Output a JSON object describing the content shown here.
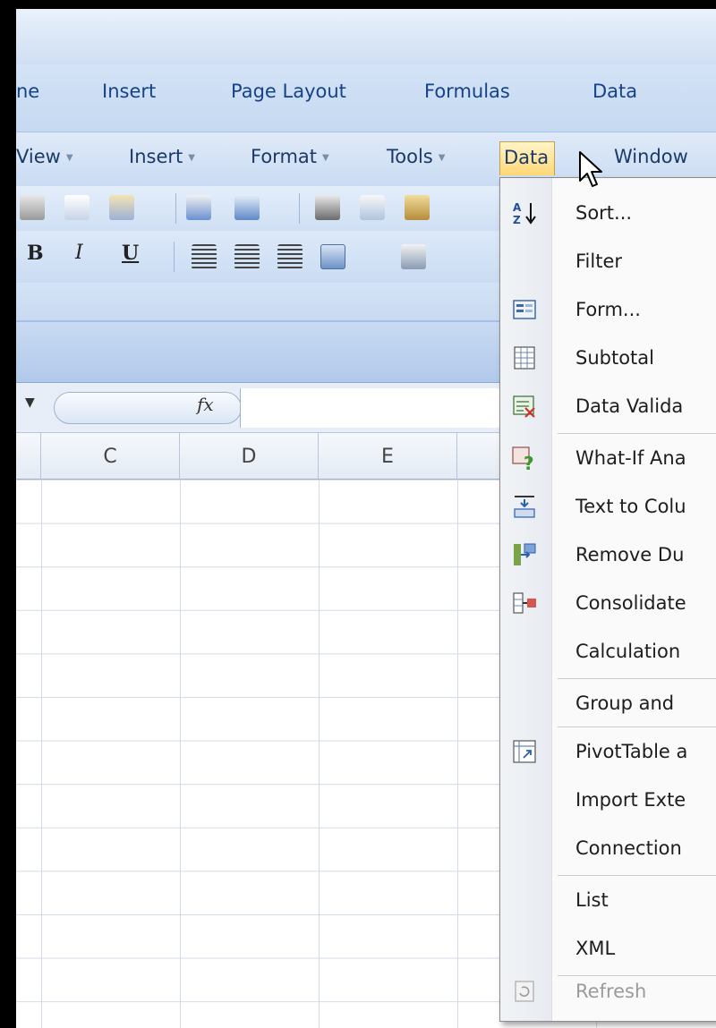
{
  "ribbon": {
    "tabs": [
      "ne",
      "Insert",
      "Page Layout",
      "Formulas",
      "Data"
    ]
  },
  "menubar": {
    "items": [
      {
        "label": "View"
      },
      {
        "label": "Insert"
      },
      {
        "label": "Format"
      },
      {
        "label": "Tools"
      },
      {
        "label": "Data"
      },
      {
        "label": "Window"
      }
    ],
    "active": "Data"
  },
  "toolbar": {
    "bold": "B",
    "italic": "I",
    "underline": "U"
  },
  "formula_bar": {
    "fx": "fx",
    "value": ""
  },
  "columns": [
    "C",
    "D",
    "E"
  ],
  "data_menu": {
    "items": [
      {
        "label": "Sort...",
        "icon": "sort-az-icon"
      },
      {
        "label": "Filter",
        "icon": ""
      },
      {
        "label": "Form...",
        "icon": "form-icon"
      },
      {
        "label": "Subtotal",
        "icon": "subtotal-icon"
      },
      {
        "label": "Data Valida",
        "icon": "data-validation-icon"
      },
      {
        "label": "What-If Ana",
        "icon": "what-if-icon"
      },
      {
        "label": "Text to Colu",
        "icon": "text-to-columns-icon"
      },
      {
        "label": "Remove Du",
        "icon": "remove-duplicates-icon"
      },
      {
        "label": "Consolidate",
        "icon": "consolidate-icon"
      },
      {
        "label": "Calculation",
        "icon": ""
      },
      {
        "label": "Group and",
        "icon": ""
      },
      {
        "label": "PivotTable a",
        "icon": "pivottable-icon"
      },
      {
        "label": "Import Exte",
        "icon": ""
      },
      {
        "label": "Connection",
        "icon": ""
      },
      {
        "label": "List",
        "icon": ""
      },
      {
        "label": "XML",
        "icon": ""
      },
      {
        "label": "Refresh",
        "icon": "refresh-icon",
        "disabled": true
      }
    ]
  }
}
